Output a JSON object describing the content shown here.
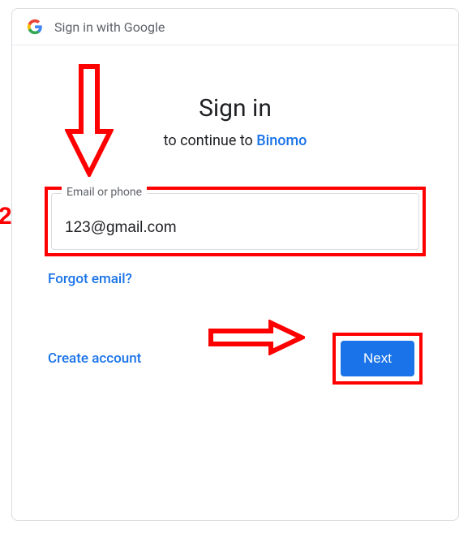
{
  "header": {
    "title": "Sign in with Google"
  },
  "main": {
    "title": "Sign in",
    "subtitle_prefix": "to continue to ",
    "app_name": "Binomo"
  },
  "email_field": {
    "label": "Email or phone",
    "value": "123@gmail.com"
  },
  "links": {
    "forgot_email": "Forgot email?",
    "create_account": "Create account"
  },
  "buttons": {
    "next": "Next"
  },
  "annotations": {
    "step_number": "2"
  },
  "colors": {
    "accent": "#1a73e8",
    "annotation": "#ff0000"
  }
}
